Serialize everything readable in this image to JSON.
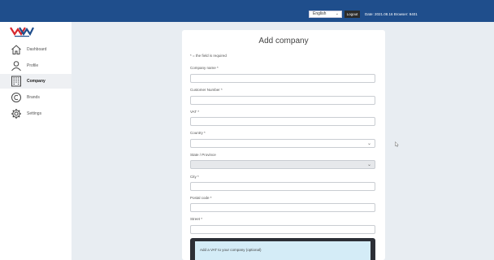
{
  "header": {
    "language": "English",
    "logout_label": "Logout",
    "date_info": "Date: 2021.08.16 Browser: 9401"
  },
  "sidebar": {
    "logo_icon": "company-logo",
    "items": [
      {
        "label": "Dashboard",
        "icon": "home-icon",
        "active": false
      },
      {
        "label": "Profile",
        "icon": "user-icon",
        "active": false
      },
      {
        "label": "Company",
        "icon": "building-icon",
        "active": true
      },
      {
        "label": "Brands",
        "icon": "copyright-icon",
        "active": false
      },
      {
        "label": "Settings",
        "icon": "gear-icon",
        "active": false
      }
    ]
  },
  "form": {
    "title": "Add company",
    "required_note": "* = the field is required",
    "fields": [
      {
        "label": "Company name *",
        "value": ""
      },
      {
        "label": "Customer Number *",
        "value": ""
      },
      {
        "label": "VAT *",
        "value": ""
      },
      {
        "label": "Country *",
        "value": ""
      },
      {
        "label": "State / Province",
        "value": ""
      },
      {
        "label": "City *",
        "value": ""
      },
      {
        "label": "Postal code *",
        "value": ""
      },
      {
        "label": "Street *",
        "value": ""
      }
    ],
    "vat_prompt": "Add a VAT to your company (optional)"
  },
  "colors": {
    "topbar": "#1f4e8c",
    "accent_red": "#d6262c",
    "vat_panel": "#d4ecf7"
  }
}
